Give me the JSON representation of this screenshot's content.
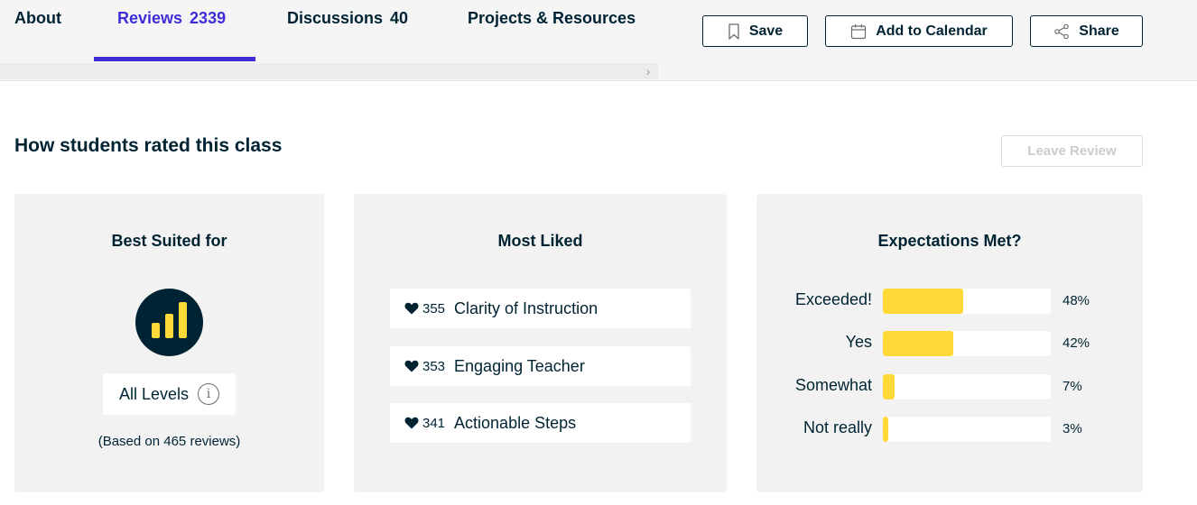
{
  "nav": {
    "tabs": [
      {
        "label": "About",
        "count": ""
      },
      {
        "label": "Reviews",
        "count": "2339"
      },
      {
        "label": "Discussions",
        "count": "40"
      },
      {
        "label": "Projects & Resources",
        "count": ""
      }
    ],
    "active_tab": "Reviews",
    "actions": {
      "save": "Save",
      "add_to_calendar": "Add to Calendar",
      "share": "Share"
    }
  },
  "section": {
    "title": "How students rated this class",
    "leave_review": "Leave Review"
  },
  "best_suited": {
    "title": "Best Suited for",
    "level": "All Levels",
    "info_glyph": "i",
    "based_on": "(Based on 465 reviews)",
    "icon": "level-bars-icon"
  },
  "most_liked": {
    "title": "Most Liked",
    "items": [
      {
        "count": "355",
        "label": "Clarity of Instruction"
      },
      {
        "count": "353",
        "label": "Engaging Teacher"
      },
      {
        "count": "341",
        "label": "Actionable Steps"
      }
    ]
  },
  "expectations": {
    "title": "Expectations Met?",
    "rows": [
      {
        "label": "Exceeded!",
        "percent_text": "48%",
        "value": 48
      },
      {
        "label": "Yes",
        "percent_text": "42%",
        "value": 42
      },
      {
        "label": "Somewhat",
        "percent_text": "7%",
        "value": 7
      },
      {
        "label": "Not really",
        "percent_text": "3%",
        "value": 3
      }
    ]
  },
  "colors": {
    "accent": "#3d2ed8",
    "text": "#002333",
    "bar": "#ffd937",
    "card": "#f2f2f2"
  }
}
